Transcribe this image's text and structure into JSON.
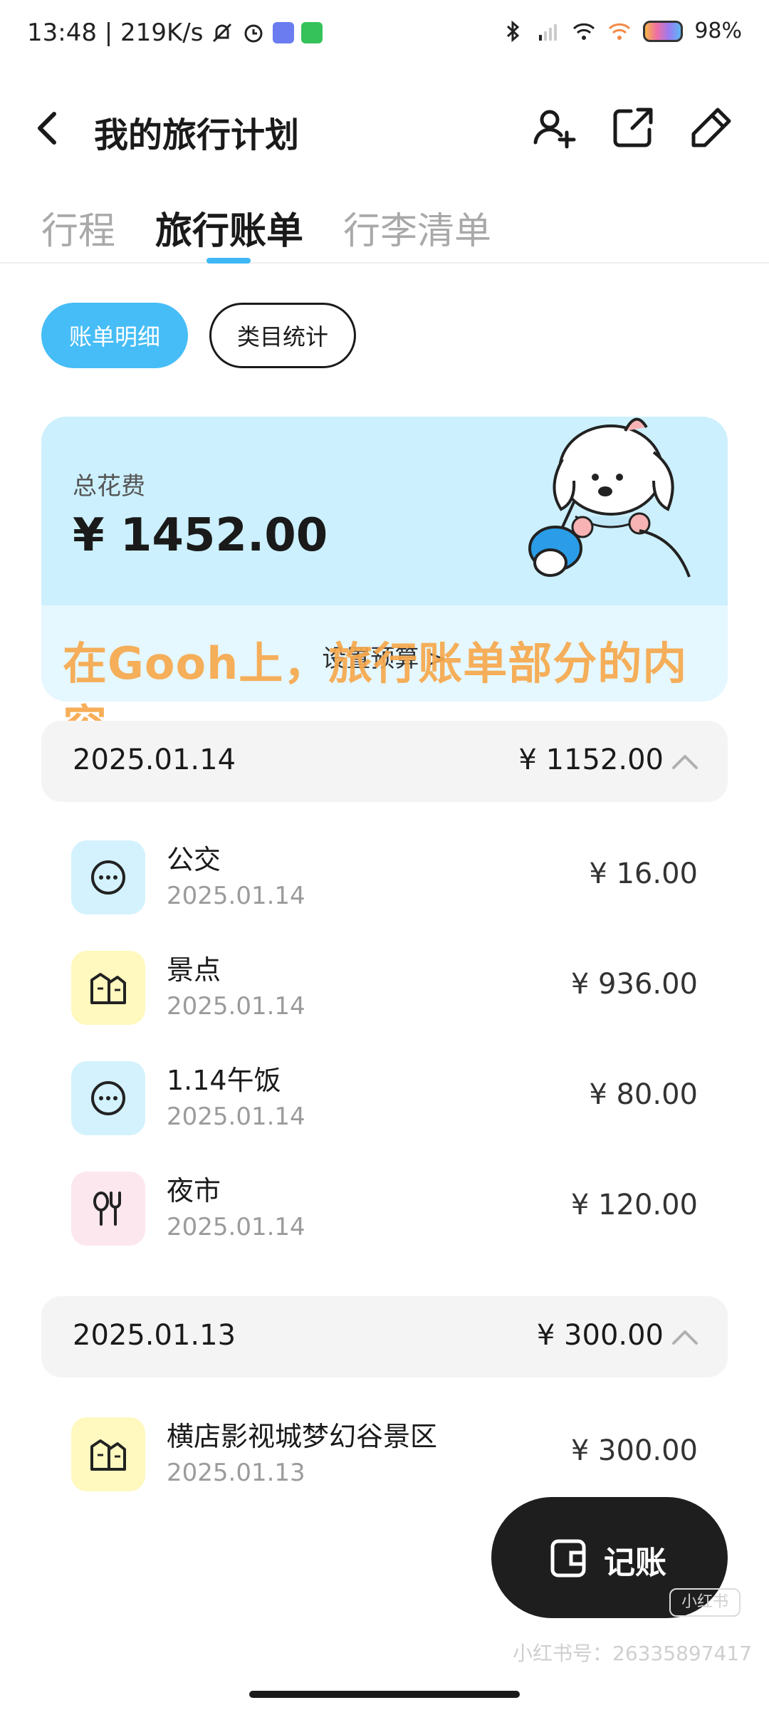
{
  "status_bar": {
    "time_speed": "13:48 | 219K/s",
    "battery": "98%"
  },
  "header": {
    "title": "我的旅行计划"
  },
  "tabs": [
    {
      "label": "行程",
      "active": false
    },
    {
      "label": "旅行账单",
      "active": true
    },
    {
      "label": "行李清单",
      "active": false
    }
  ],
  "segments": {
    "detail": "账单明细",
    "stats": "类目统计"
  },
  "summary": {
    "label": "总花费",
    "total": "¥ 1452.00",
    "budget_link": "设置预算 >"
  },
  "caption": "在Gooh上，旅行账单部分的内容",
  "days": [
    {
      "date": "2025.01.14",
      "total": "¥ 1152.00",
      "items": [
        {
          "name": "公交",
          "date": "2025.01.14",
          "amount": "¥ 16.00",
          "icon": "more-dots-icon",
          "color": "#d3f2fd"
        },
        {
          "name": "景点",
          "date": "2025.01.14",
          "amount": "¥ 936.00",
          "icon": "attraction-icon",
          "color": "#fff8bf"
        },
        {
          "name": "1.14午饭",
          "date": "2025.01.14",
          "amount": "¥ 80.00",
          "icon": "more-dots-icon",
          "color": "#d3f2fd"
        },
        {
          "name": "夜市",
          "date": "2025.01.14",
          "amount": "¥ 120.00",
          "icon": "food-icon",
          "color": "#fde7ef"
        }
      ]
    },
    {
      "date": "2025.01.13",
      "total": "¥ 300.00",
      "items": [
        {
          "name": "横店影视城梦幻谷景区",
          "date": "2025.01.13",
          "amount": "¥ 300.00",
          "icon": "attraction-icon",
          "color": "#fff8bf"
        }
      ]
    }
  ],
  "fab": {
    "label": "记账"
  },
  "watermark": {
    "badge": "小红书",
    "text": "小红书号：26335897417"
  }
}
